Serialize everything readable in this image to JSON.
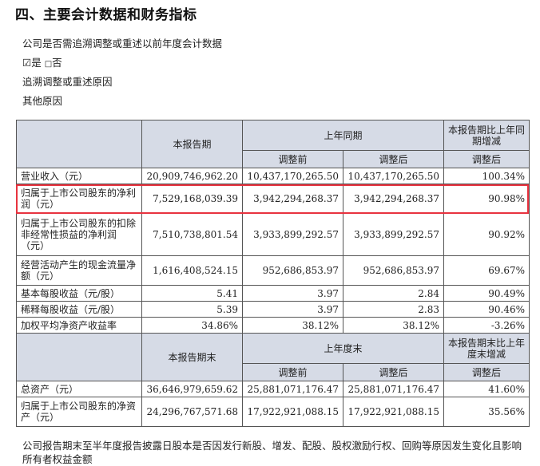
{
  "section_title": "四、主要会计数据和财务指标",
  "retro_question": "公司是否需追溯调整或重述以前年度会计数据",
  "option_yes_mark": "☑",
  "option_yes": "是",
  "option_no_mark": "□",
  "option_no": "否",
  "retro_reason_label": "追溯调整或重述原因",
  "other_reason_label": "其他原因",
  "table1": {
    "h_current": "本报告期",
    "h_prior": "上年同期",
    "h_change": "本报告期比上年同期增减",
    "h_before": "调整前",
    "h_after": "调整后",
    "h_after2": "调整后",
    "rows": [
      {
        "label": "营业收入（元）",
        "cur": "20,909,746,962.20",
        "before": "10,437,170,265.50",
        "after": "10,437,170,265.50",
        "chg": "100.34%"
      },
      {
        "label": "归属于上市公司股东的净利润（元）",
        "cur": "7,529,168,039.39",
        "before": "3,942,294,268.37",
        "after": "3,942,294,268.37",
        "chg": "90.98%"
      },
      {
        "label": "归属于上市公司股东的扣除非经常性损益的净利润（元）",
        "cur": "7,510,738,801.54",
        "before": "3,933,899,292.57",
        "after": "3,933,899,292.57",
        "chg": "90.92%"
      },
      {
        "label": "经营活动产生的现金流量净额（元）",
        "cur": "1,616,408,524.15",
        "before": "952,686,853.97",
        "after": "952,686,853.97",
        "chg": "69.67%"
      },
      {
        "label": "基本每股收益（元/股）",
        "cur": "5.41",
        "before": "3.97",
        "after": "2.84",
        "chg": "90.49%"
      },
      {
        "label": "稀释每股收益（元/股）",
        "cur": "5.39",
        "before": "3.97",
        "after": "2.83",
        "chg": "90.46%"
      },
      {
        "label": "加权平均净资产收益率",
        "cur": "34.86%",
        "before": "38.12%",
        "after": "38.12%",
        "chg": "-3.26%"
      }
    ]
  },
  "table2": {
    "h_current": "本报告期末",
    "h_prior": "上年度末",
    "h_change": "本报告期末比上年度末增减",
    "h_before": "调整前",
    "h_after": "调整后",
    "h_after2": "调整后",
    "rows": [
      {
        "label": "总资产（元）",
        "cur": "36,646,979,659.62",
        "before": "25,881,071,176.47",
        "after": "25,881,071,176.47",
        "chg": "41.60%"
      },
      {
        "label": "归属于上市公司股东的净资产（元）",
        "cur": "24,296,767,571.68",
        "before": "17,922,921,088.15",
        "after": "17,922,921,088.15",
        "chg": "35.56%"
      }
    ]
  },
  "footnote": "公司报告期末至半年度报告披露日股本是否因发行新股、增发、配股、股权激励行权、回购等原因发生变化且影响所有者权益金额"
}
